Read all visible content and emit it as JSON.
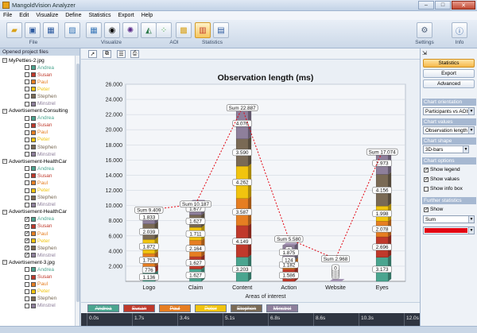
{
  "window": {
    "title": "MangoldVision Analyzer",
    "minimize": "–",
    "maximize": "□",
    "close": "✕"
  },
  "menu": [
    "File",
    "Edit",
    "Visualize",
    "Define",
    "Statistics",
    "Export",
    "Help"
  ],
  "ribbon": {
    "groups": [
      {
        "label": "File"
      },
      {
        "label": "Visualize"
      },
      {
        "label": "AOI"
      },
      {
        "label": "Statistics"
      }
    ],
    "right_buttons": [
      {
        "label": "Settings"
      },
      {
        "label": "Info"
      }
    ]
  },
  "project_panel": {
    "header": "Opened project files",
    "files": [
      {
        "name": "MyPetties-2.jpg",
        "participants": [
          {
            "name": "Andrea",
            "checked": false,
            "color": "#4aa58f"
          },
          {
            "name": "Susan",
            "checked": false,
            "color": "#c0392b"
          },
          {
            "name": "Paul",
            "checked": false,
            "color": "#e67e22"
          },
          {
            "name": "Peter",
            "checked": false,
            "color": "#f1c40f"
          },
          {
            "name": "Stephen",
            "checked": false,
            "color": "#7a6a55"
          },
          {
            "name": "Minstrel",
            "checked": false,
            "color": "#8e7f9b"
          }
        ]
      },
      {
        "name": "Advertisement-Consulting",
        "participants": [
          {
            "name": "Andrea",
            "checked": false,
            "color": "#4aa58f"
          },
          {
            "name": "Susan",
            "checked": false,
            "color": "#c0392b"
          },
          {
            "name": "Paul",
            "checked": false,
            "color": "#e67e22"
          },
          {
            "name": "Peter",
            "checked": false,
            "color": "#f1c40f"
          },
          {
            "name": "Stephen",
            "checked": false,
            "color": "#7a6a55"
          },
          {
            "name": "Minstrel",
            "checked": false,
            "color": "#8e7f9b"
          }
        ]
      },
      {
        "name": "Advertisement-HealthCar",
        "participants": [
          {
            "name": "Andrea",
            "checked": false,
            "color": "#4aa58f"
          },
          {
            "name": "Susan",
            "checked": false,
            "color": "#c0392b"
          },
          {
            "name": "Paul",
            "checked": false,
            "color": "#e67e22"
          },
          {
            "name": "Peter",
            "checked": false,
            "color": "#f1c40f"
          },
          {
            "name": "Stephen",
            "checked": false,
            "color": "#7a6a55"
          },
          {
            "name": "Minstrel",
            "checked": false,
            "color": "#8e7f9b"
          }
        ]
      },
      {
        "name": "Advertisement-HealthCar",
        "participants": [
          {
            "name": "Andrea",
            "checked": true,
            "color": "#4aa58f"
          },
          {
            "name": "Susan",
            "checked": true,
            "color": "#c0392b"
          },
          {
            "name": "Paul",
            "checked": true,
            "color": "#e67e22"
          },
          {
            "name": "Peter",
            "checked": true,
            "color": "#f1c40f"
          },
          {
            "name": "Stephen",
            "checked": true,
            "color": "#7a6a55"
          },
          {
            "name": "Minstrel",
            "checked": true,
            "color": "#8e7f9b"
          }
        ]
      },
      {
        "name": "Advertisement-3.jpg",
        "participants": [
          {
            "name": "Andrea",
            "checked": false,
            "color": "#4aa58f"
          },
          {
            "name": "Susan",
            "checked": false,
            "color": "#c0392b"
          },
          {
            "name": "Paul",
            "checked": false,
            "color": "#e67e22"
          },
          {
            "name": "Peter",
            "checked": false,
            "color": "#f1c40f"
          },
          {
            "name": "Stephen",
            "checked": false,
            "color": "#7a6a55"
          },
          {
            "name": "Minstrel",
            "checked": false,
            "color": "#8e7f9b"
          }
        ]
      }
    ]
  },
  "right_panel": {
    "buttons": [
      "Statistics",
      "Export",
      "Advanced"
    ],
    "orientation": {
      "header": "Chart orientation",
      "value": "Participants vs AOIs"
    },
    "values": {
      "header": "Chart values",
      "value": "Observation length"
    },
    "shape": {
      "header": "Chart shape",
      "value": "3D-bars"
    },
    "options": {
      "header": "Chart options",
      "items": [
        {
          "label": "Show legend",
          "checked": true
        },
        {
          "label": "Show values",
          "checked": true
        },
        {
          "label": "Show info box",
          "checked": false
        }
      ]
    },
    "further": {
      "header": "Further statistics",
      "show_label": "Show",
      "show_checked": true,
      "stat": "Sum",
      "line_color": "#e30613"
    }
  },
  "timeline": {
    "ticks": [
      "0.0s",
      "1.7s",
      "3.4s",
      "5.1s",
      "6.8s",
      "8.6s",
      "10.3s",
      "12.0s"
    ]
  },
  "chart_data": {
    "type": "bar",
    "stacked": true,
    "shape": "3D-bars",
    "title": "Observation length (ms)",
    "xlabel": "Areas of interest",
    "ylabel": "",
    "ylim": [
      0,
      26000
    ],
    "yticks": [
      "2.000",
      "4.000",
      "6.000",
      "8.000",
      "10.000",
      "12.000",
      "14.000",
      "16.000",
      "18.000",
      "20.000",
      "22.000",
      "24.000",
      "26.000"
    ],
    "grid": true,
    "categories": [
      "Logo",
      "Claim",
      "Content",
      "Action",
      "Website",
      "Eyes"
    ],
    "series": [
      {
        "name": "Andrea",
        "color": "#4aa58f",
        "values": [
          1136,
          1627,
          3203,
          0,
          0,
          3173
        ]
      },
      {
        "name": "Susan",
        "color": "#c0392b",
        "values": [
          776,
          1627,
          4149,
          1586,
          0,
          2696
        ]
      },
      {
        "name": "Paul",
        "color": "#e67e22",
        "values": [
          1753,
          2164,
          3587,
          1182,
          0,
          2078
        ]
      },
      {
        "name": "Peter",
        "color": "#f1c40f",
        "values": [
          1872,
          1711,
          4262,
          0,
          0,
          1998
        ]
      },
      {
        "name": "Stephen",
        "color": "#7a6a55",
        "values": [
          2039,
          1627,
          3590,
          124,
          0,
          4156
        ]
      },
      {
        "name": "Minstrel",
        "color": "#8e7f9b",
        "values": [
          1833,
          1677,
          4076,
          1875,
          0,
          2973
        ]
      }
    ],
    "sums": [
      {
        "label": "Sum 9.409",
        "value": 9409
      },
      {
        "label": "Sum 10.187",
        "value": 10187
      },
      {
        "label": "Sum 22.887",
        "value": 22887
      },
      {
        "label": "Sum 5.580",
        "value": 5580
      },
      {
        "label": "Sum 2.968",
        "value": 2968
      },
      {
        "label": "Sum 17.074",
        "value": 17074
      }
    ],
    "value_labels": [
      [
        "1.136",
        "776",
        "1.753",
        "1.872",
        "2.039",
        "1.833"
      ],
      [
        "1.627",
        "1.627",
        "2.164",
        "1.711",
        "1.627",
        "1.677"
      ],
      [
        "3.203",
        "4.149",
        "3.587",
        "4.262",
        "3.590",
        "4.076"
      ],
      [
        "0",
        "1.586",
        "1.182",
        "0",
        "124",
        "1.875"
      ],
      [
        "0",
        "0",
        "0",
        "0",
        "0",
        "0"
      ],
      [
        "3.173",
        "2.696",
        "2.078",
        "1.998",
        "4.156",
        "2.973"
      ]
    ],
    "legend": [
      "Andrea",
      "Susan",
      "Paul",
      "Peter",
      "Stephen",
      "Minstrel"
    ],
    "legend_position": "bottom"
  }
}
